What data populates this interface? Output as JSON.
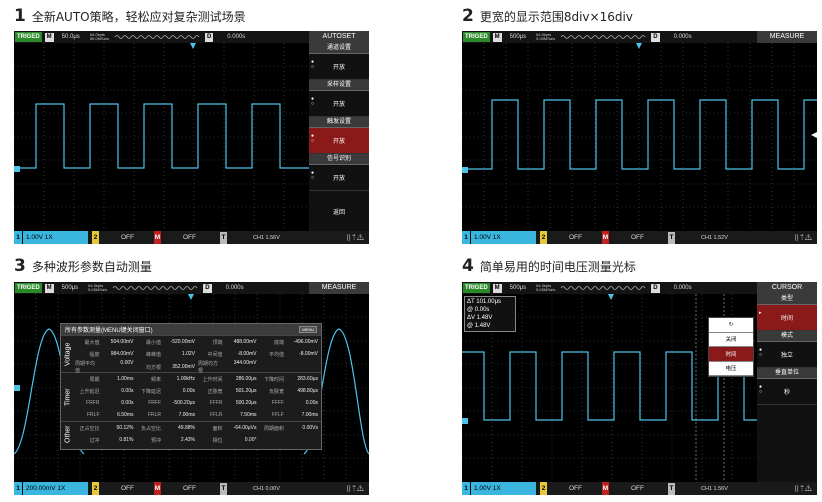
{
  "captions": [
    {
      "num": "1",
      "text": "全新AUTO策略，轻松应对复杂测试场景"
    },
    {
      "num": "2",
      "text": "更宽的显示范围8div×16div"
    },
    {
      "num": "3",
      "text": "多种波形参数自动测量"
    },
    {
      "num": "4",
      "text": "简单易用的时间电压测量光标"
    }
  ],
  "scopes": [
    {
      "trig": "TRIGED",
      "m": "M",
      "timebase": "50.0μs",
      "rate1": "64.0kpts",
      "rate2": "50.0MSa/s",
      "d": "D",
      "pos": "0.000s",
      "mode": "AUTOSET",
      "ch1": "1",
      "ch1v": "1.00V 1X",
      "ch2": "2",
      "off1": "OFF",
      "mch": "M",
      "off2": "OFF",
      "tch": "T",
      "trigval": "CH1 1.56V",
      "menu": [
        {
          "header": "通道设置",
          "value": "开放",
          "selected": false
        },
        {
          "header": "采样设置",
          "value": "开放",
          "selected": false
        },
        {
          "header": "触发设置",
          "value": "开放",
          "selected": true
        },
        {
          "header": "信号识别",
          "value": "开放",
          "selected": false
        }
      ],
      "menu_back": "返回"
    },
    {
      "trig": "TRIGED",
      "m": "M",
      "timebase": "500μs",
      "rate1": "64.0kpts",
      "rate2": "5.00MSa/s",
      "d": "D",
      "pos": "0.000s",
      "mode": "MEASURE",
      "ch1": "1",
      "ch1v": "1.00V 1X",
      "ch2": "2",
      "off1": "OFF",
      "mch": "M",
      "off2": "OFF",
      "tch": "T",
      "trigval": "CH1 1.52V"
    },
    {
      "trig": "TRIGED",
      "m": "M",
      "timebase": "500μs",
      "rate1": "64.0kpts",
      "rate2": "5.00MSa/s",
      "d": "D",
      "pos": "0.000s",
      "mode": "MEASURE",
      "ch1": "1",
      "ch1v": "200.00mV 1X",
      "ch2": "2",
      "off1": "OFF",
      "mch": "M",
      "off2": "OFF",
      "tch": "T",
      "trigval": "CH1 0.00V",
      "panel": {
        "title": "所有参数测量(MENU键关闭窗口)",
        "button": "MENU",
        "sections": [
          {
            "label": "Voltage",
            "rows": [
              [
                [
                  "最大值",
                  "504.00mV"
                ],
                [
                  "最小值",
                  "-520.00mV"
                ],
                [
                  "顶端",
                  "488.00mV"
                ],
                [
                  "底端",
                  "-496.00mV"
                ]
              ],
              [
                [
                  "幅度",
                  "984.00mV"
                ],
                [
                  "峰峰值",
                  "1.02V"
                ],
                [
                  "中间值",
                  "-8.00mV"
                ],
                [
                  "平均值",
                  "-8.00mV"
                ]
              ],
              [
                [
                  "周期平均值",
                  "0.00V"
                ],
                [
                  "均方根",
                  "352.00mV"
                ],
                [
                  "周期均方根",
                  "344.00mV"
                ],
                [
                  "",
                  ""
                ]
              ]
            ]
          },
          {
            "label": "Timer",
            "rows": [
              [
                [
                  "周期",
                  "1.00ms"
                ],
                [
                  "频率",
                  "1.00kHz"
                ],
                [
                  "上升时间",
                  "286.00μs"
                ],
                [
                  "下降时间",
                  "283.60μs"
                ]
              ],
              [
                [
                  "上升延迟",
                  "0.00s"
                ],
                [
                  "下降延迟",
                  "0.00s"
                ],
                [
                  "正脉宽",
                  "501.20μs"
                ],
                [
                  "负脉宽",
                  "498.80μs"
                ]
              ],
              [
                [
                  "FRFR",
                  "0.00s"
                ],
                [
                  "FRFF",
                  "-500.20μs"
                ],
                [
                  "FFFR",
                  "500.20μs"
                ],
                [
                  "FFFF",
                  "0.00s"
                ]
              ],
              [
                [
                  "FRLF",
                  "6.50ms"
                ],
                [
                  "FRLR",
                  "7.00ms"
                ],
                [
                  "FFLR",
                  "7.50ms"
                ],
                [
                  "FFLF",
                  "7.00ms"
                ]
              ]
            ]
          },
          {
            "label": "Other",
            "rows": [
              [
                [
                  "正占空比",
                  "50.12%"
                ],
                [
                  "负占空比",
                  "49.88%"
                ],
                [
                  "面积",
                  "-64.00μVs"
                ],
                [
                  "周期面积",
                  "0.00Vs"
                ]
              ],
              [
                [
                  "过冲",
                  "0.81%"
                ],
                [
                  "预冲",
                  "2.43%"
                ],
                [
                  "相位",
                  "0.00°"
                ],
                [
                  "",
                  ""
                ]
              ]
            ]
          }
        ]
      }
    },
    {
      "trig": "TRIGED",
      "m": "M",
      "timebase": "500μs",
      "rate1": "64.0kpts",
      "rate2": "5.00MSa/s",
      "d": "D",
      "pos": "0.000s",
      "mode": "CURSOR",
      "ch1": "1",
      "ch1v": "1.00V 1X",
      "ch2": "2",
      "off1": "OFF",
      "mch": "M",
      "off2": "OFF",
      "tch": "T",
      "trigval": "CH1 1.56V",
      "cursor": {
        "dt": "ΔT 101.00μs",
        "dt2": "@ 0.00s",
        "dv": "ΔV 1.48V",
        "dv2": "@ 1.48V"
      },
      "popup": {
        "off": "关闭",
        "time": "时间",
        "volt": "电压"
      },
      "menu": [
        {
          "header": "类型",
          "value": "时间",
          "selected": true
        },
        {
          "header": "模式",
          "value": "独立",
          "selected": false
        },
        {
          "header": "垂直单位",
          "value": "秒",
          "selected": false
        }
      ]
    }
  ]
}
